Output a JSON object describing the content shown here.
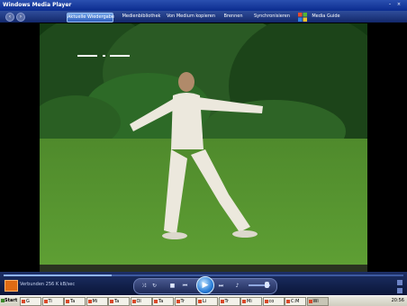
{
  "window": {
    "title": "Windows Media Player"
  },
  "nav": {
    "tabs": [
      {
        "label": "Aktuelle Wiedergabe",
        "active": true
      },
      {
        "label": "Medienbibliothek"
      },
      {
        "label": "Von Medium kopieren"
      },
      {
        "label": "Brennen"
      },
      {
        "label": "Synchronisieren"
      },
      {
        "label": "Media Guide"
      }
    ]
  },
  "player": {
    "status": "Verbunden 256 K kB/sec",
    "elapsed": "00:00",
    "progress": 0.27,
    "volume": 0.75
  },
  "taskbar": {
    "start_label": "Start",
    "tasks": [
      "G",
      "Ti",
      "Ta",
      "Mi",
      "Ta",
      "Ol",
      "Ta",
      "Tr",
      "Li",
      "Tr",
      "Mi",
      "co",
      "C:M",
      "Wi"
    ],
    "clock": "20:56"
  },
  "colors": {
    "accent": "#2f5fbd",
    "grass": "#4f8a2c",
    "taskbar": "#d8d6c8"
  }
}
